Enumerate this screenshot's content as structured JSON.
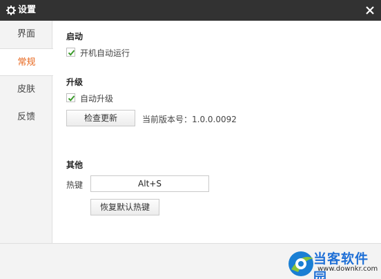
{
  "window": {
    "title": "设置",
    "close_icon": "close-icon",
    "settings_icon": "gear-icon"
  },
  "sidebar": {
    "items": [
      {
        "label": "界面"
      },
      {
        "label": "常规",
        "active": true
      },
      {
        "label": "皮肤"
      },
      {
        "label": "反馈"
      }
    ],
    "accent_color": "#e7661c"
  },
  "startup": {
    "title": "启动",
    "autorun_label": "开机自动运行",
    "autorun_checked": true
  },
  "upgrade": {
    "title": "升级",
    "auto_upgrade_label": "自动升级",
    "auto_upgrade_checked": true,
    "check_button": "检查更新",
    "version_text": "当前版本号：1.0.0.0092"
  },
  "other": {
    "title": "其他",
    "hotkey_label": "热键",
    "hotkey_value": "Alt+S",
    "restore_button": "恢复默认热键"
  },
  "watermark": {
    "text": "当客软件园",
    "url": "www.downkr.com"
  }
}
